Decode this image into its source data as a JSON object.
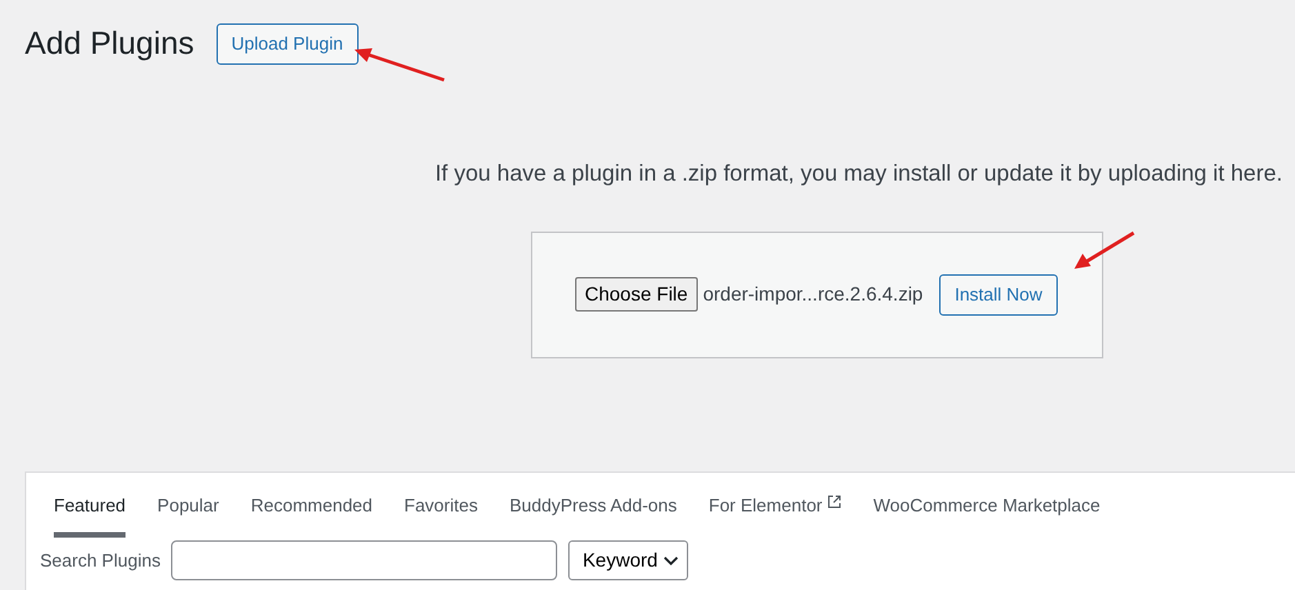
{
  "page_title": "Add Plugins",
  "upload_button": "Upload Plugin",
  "upload_help": "If you have a plugin in a .zip format, you may install or update it by uploading it here.",
  "upload_form": {
    "choose_button": "Choose File",
    "file_name": "order-impor...rce.2.6.4.zip",
    "install_button": "Install Now"
  },
  "tabs": [
    {
      "label": "Featured",
      "selected": true,
      "external": false
    },
    {
      "label": "Popular",
      "selected": false,
      "external": false
    },
    {
      "label": "Recommended",
      "selected": false,
      "external": false
    },
    {
      "label": "Favorites",
      "selected": false,
      "external": false
    },
    {
      "label": "BuddyPress Add-ons",
      "selected": false,
      "external": false
    },
    {
      "label": "For Elementor",
      "selected": false,
      "external": true
    },
    {
      "label": "WooCommerce Marketplace",
      "selected": false,
      "external": false
    }
  ],
  "search": {
    "label": "Search Plugins",
    "type_select": "Keyword"
  }
}
